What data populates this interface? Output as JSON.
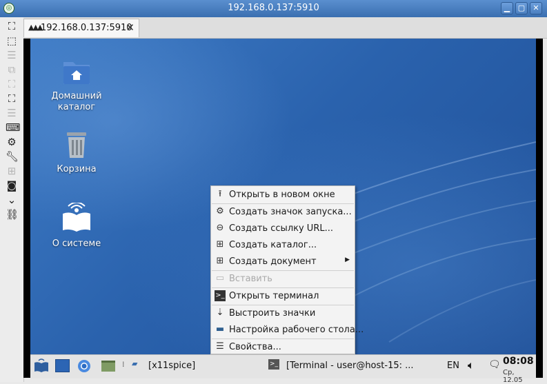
{
  "window": {
    "title": "192.168.0.137:5910"
  },
  "tab": {
    "label": "192.168.0.137:5910",
    "close": "✕"
  },
  "desktop": {
    "icons": [
      {
        "label_line1": "Домашний",
        "label_line2": "каталог"
      },
      {
        "label": "Корзина"
      },
      {
        "label": "О системе"
      }
    ]
  },
  "context_menu": {
    "items": [
      {
        "label": "Открыть в новом окне"
      },
      {
        "label": "Создать значок запуска..."
      },
      {
        "label": "Создать ссылку URL..."
      },
      {
        "label": "Создать каталог..."
      },
      {
        "label": "Создать документ"
      },
      {
        "label": "Вставить"
      },
      {
        "label": "Открыть терминал"
      },
      {
        "label": "Выстроить значки"
      },
      {
        "label": "Настройка рабочего стола..."
      },
      {
        "label": "Свойства..."
      }
    ]
  },
  "taskbar": {
    "task1": "[x11spice]",
    "task2": "[Terminal - user@host-15: ...",
    "lang": "EN",
    "time": "08:08",
    "date": "Ср, 12.05"
  },
  "colors": {
    "titlebar": "#4a7fc0",
    "desktop": "#2a62ad",
    "menu_bg": "#f3f3f3"
  }
}
